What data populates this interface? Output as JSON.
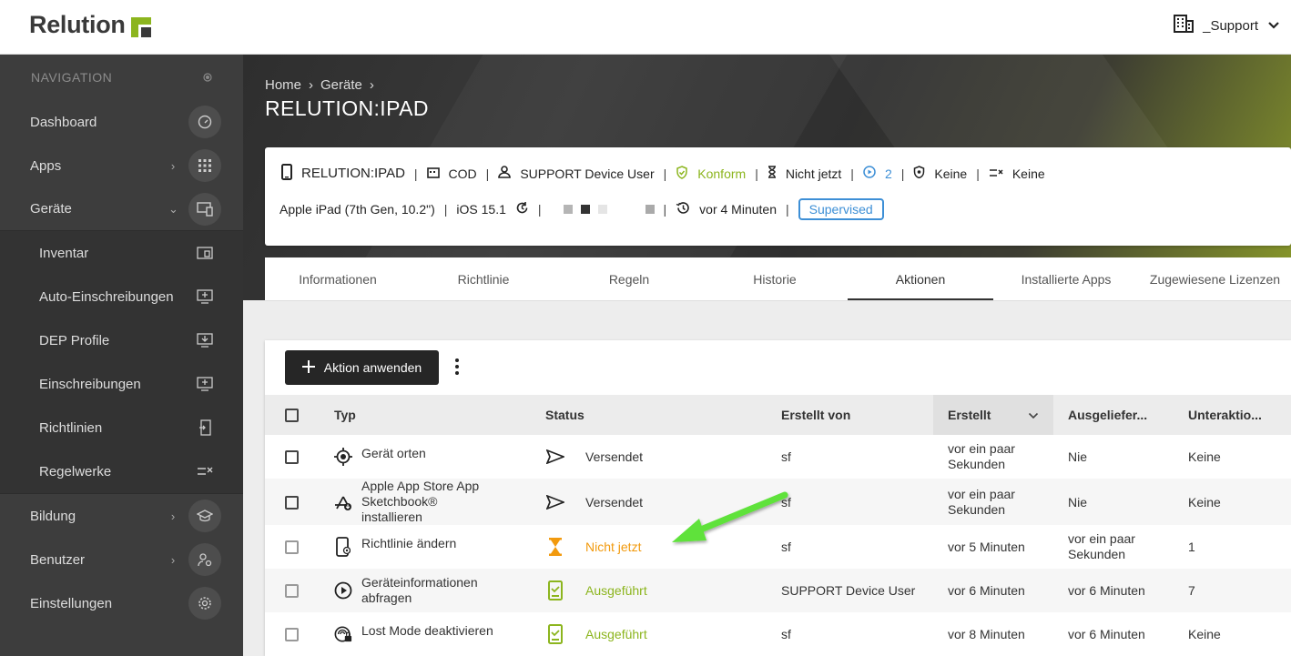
{
  "app": {
    "logo_text": "Relution",
    "tenant": "_Support"
  },
  "nav": {
    "heading": "NAVIGATION",
    "items": [
      {
        "label": "Dashboard",
        "icon": "gauge-icon"
      },
      {
        "label": "Apps",
        "icon": "grid-icon"
      },
      {
        "label": "Geräte",
        "icon": "devices-icon"
      }
    ],
    "sub_items": [
      {
        "label": "Inventar"
      },
      {
        "label": "Auto-Einschreibungen"
      },
      {
        "label": "DEP Profile"
      },
      {
        "label": "Einschreibungen"
      },
      {
        "label": "Richtlinien"
      },
      {
        "label": "Regelwerke"
      }
    ],
    "bottom_items": [
      {
        "label": "Bildung"
      },
      {
        "label": "Benutzer"
      },
      {
        "label": "Einstellungen"
      }
    ]
  },
  "breadcrumb": {
    "home": "Home",
    "devices": "Geräte"
  },
  "device": {
    "title": "RELUTION:IPAD",
    "name": "RELUTION:IPAD",
    "ownership": "COD",
    "user": "SUPPORT Device User",
    "compliance": "Konform",
    "pending": "Nicht jetzt",
    "actions_count": "2",
    "policy": "Keine",
    "rules": "Keine",
    "model": "Apple iPad (7th Gen, 10.2\")",
    "os": "iOS 15.1",
    "last_seen": "vor 4 Minuten",
    "supervised": "Supervised"
  },
  "tabs": [
    "Informationen",
    "Richtlinie",
    "Regeln",
    "Historie",
    "Aktionen",
    "Installierte Apps",
    "Zugewiesene Lizenzen"
  ],
  "actions": {
    "apply_label": "Aktion anwenden",
    "columns": {
      "typ": "Typ",
      "status": "Status",
      "created_by": "Erstellt von",
      "created": "Erstellt",
      "delivered": "Ausgeliefer...",
      "subactions": "Unteraktio..."
    },
    "rows": [
      {
        "typ": "Gerät orten",
        "status": "Versendet",
        "created_by": "sf",
        "created": "vor ein paar Sekunden",
        "delivered": "Nie",
        "subactions": "Keine"
      },
      {
        "typ": "Apple App Store App Sketchbook® installieren",
        "status": "Versendet",
        "created_by": "sf",
        "created": "vor ein paar Sekunden",
        "delivered": "Nie",
        "subactions": "Keine"
      },
      {
        "typ": "Richtlinie ändern",
        "status": "Nicht jetzt",
        "created_by": "sf",
        "created": "vor 5 Minuten",
        "delivered": "vor ein paar Sekunden",
        "subactions": "1"
      },
      {
        "typ": "Geräteinformationen abfragen",
        "status": "Ausgeführt",
        "created_by": "SUPPORT Device User",
        "created": "vor 6 Minuten",
        "delivered": "vor 6 Minuten",
        "subactions": "7"
      },
      {
        "typ": "Lost Mode deaktivieren",
        "status": "Ausgeführt",
        "created_by": "sf",
        "created": "vor 8 Minuten",
        "delivered": "vor 6 Minuten",
        "subactions": "Keine"
      }
    ]
  },
  "colors": {
    "accent_green": "#8cb51e",
    "accent_blue": "#3d8fd6",
    "warning_orange": "#f29a0e",
    "sidebar_bg": "#3d3d3d"
  }
}
